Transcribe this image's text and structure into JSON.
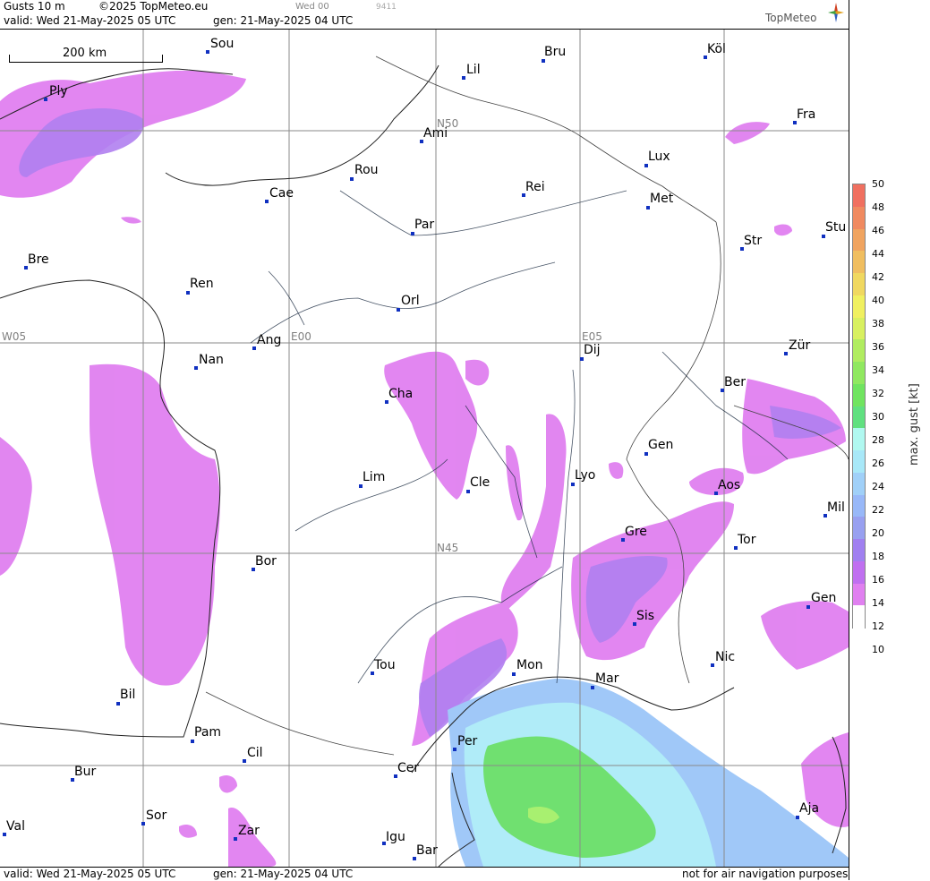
{
  "header": {
    "title": "Gusts 10 m",
    "copyright": "©2025 TopMeteo.eu",
    "valid": "valid:  Wed  21-May-2025  05 UTC",
    "gen": "gen: 21-May-2025 04 UTC",
    "run": "Wed 00",
    "code": "9411",
    "logo": "TopMeteo"
  },
  "footer": {
    "valid": "valid:  Wed  21-May-2025  05 UTC",
    "gen": "gen: 21-May-2025 04 UTC",
    "disclaimer": "not for air navigation purposes"
  },
  "scale": {
    "label": "200 km"
  },
  "grid_labels": {
    "n50": "N50",
    "n45": "N45",
    "w05": "W05",
    "e00": "E00",
    "e05": "E05"
  },
  "cities": [
    {
      "name": "Sou"
    },
    {
      "name": "Ply"
    },
    {
      "name": "Lil"
    },
    {
      "name": "Bru"
    },
    {
      "name": "Köl"
    },
    {
      "name": "Ami"
    },
    {
      "name": "Fra"
    },
    {
      "name": "Rou"
    },
    {
      "name": "Lux"
    },
    {
      "name": "Cae"
    },
    {
      "name": "Rei"
    },
    {
      "name": "Met"
    },
    {
      "name": "Par"
    },
    {
      "name": "Stu"
    },
    {
      "name": "Bre"
    },
    {
      "name": "Str"
    },
    {
      "name": "Ren"
    },
    {
      "name": "Orl"
    },
    {
      "name": "Ang"
    },
    {
      "name": "Dij"
    },
    {
      "name": "Zür"
    },
    {
      "name": "Nan"
    },
    {
      "name": "Ber"
    },
    {
      "name": "Cha"
    },
    {
      "name": "Gen"
    },
    {
      "name": "Lim"
    },
    {
      "name": "Cle"
    },
    {
      "name": "Lyo"
    },
    {
      "name": "Aos"
    },
    {
      "name": "Mil"
    },
    {
      "name": "Gre"
    },
    {
      "name": "Tor"
    },
    {
      "name": "Bor"
    },
    {
      "name": "Sis"
    },
    {
      "name": "Gen"
    },
    {
      "name": "Tou"
    },
    {
      "name": "Mon"
    },
    {
      "name": "Nic"
    },
    {
      "name": "Mar"
    },
    {
      "name": "Bil"
    },
    {
      "name": "Pam"
    },
    {
      "name": "Cil"
    },
    {
      "name": "Per"
    },
    {
      "name": "Bur"
    },
    {
      "name": "Cer"
    },
    {
      "name": "Aja"
    },
    {
      "name": "Sor"
    },
    {
      "name": "Val"
    },
    {
      "name": "Zar"
    },
    {
      "name": "Igu"
    },
    {
      "name": "Bar"
    }
  ],
  "legend": {
    "title": "max. gust  [kt]",
    "ticks": [
      "50",
      "48",
      "46",
      "44",
      "42",
      "40",
      "38",
      "36",
      "34",
      "32",
      "30",
      "28",
      "26",
      "24",
      "22",
      "20",
      "18",
      "16",
      "14",
      "12",
      "10"
    ],
    "colors": [
      "#f07060",
      "#f08a60",
      "#f0a460",
      "#f0be60",
      "#f0d860",
      "#f0f060",
      "#d8f060",
      "#b0ec60",
      "#90e860",
      "#70e460",
      "#60e080",
      "#b0f8f0",
      "#a8e8f8",
      "#a0d0f8",
      "#98b8f8",
      "#98a0f0",
      "#a080f0",
      "#c070f0",
      "#e080f0",
      "#ffffff"
    ]
  }
}
